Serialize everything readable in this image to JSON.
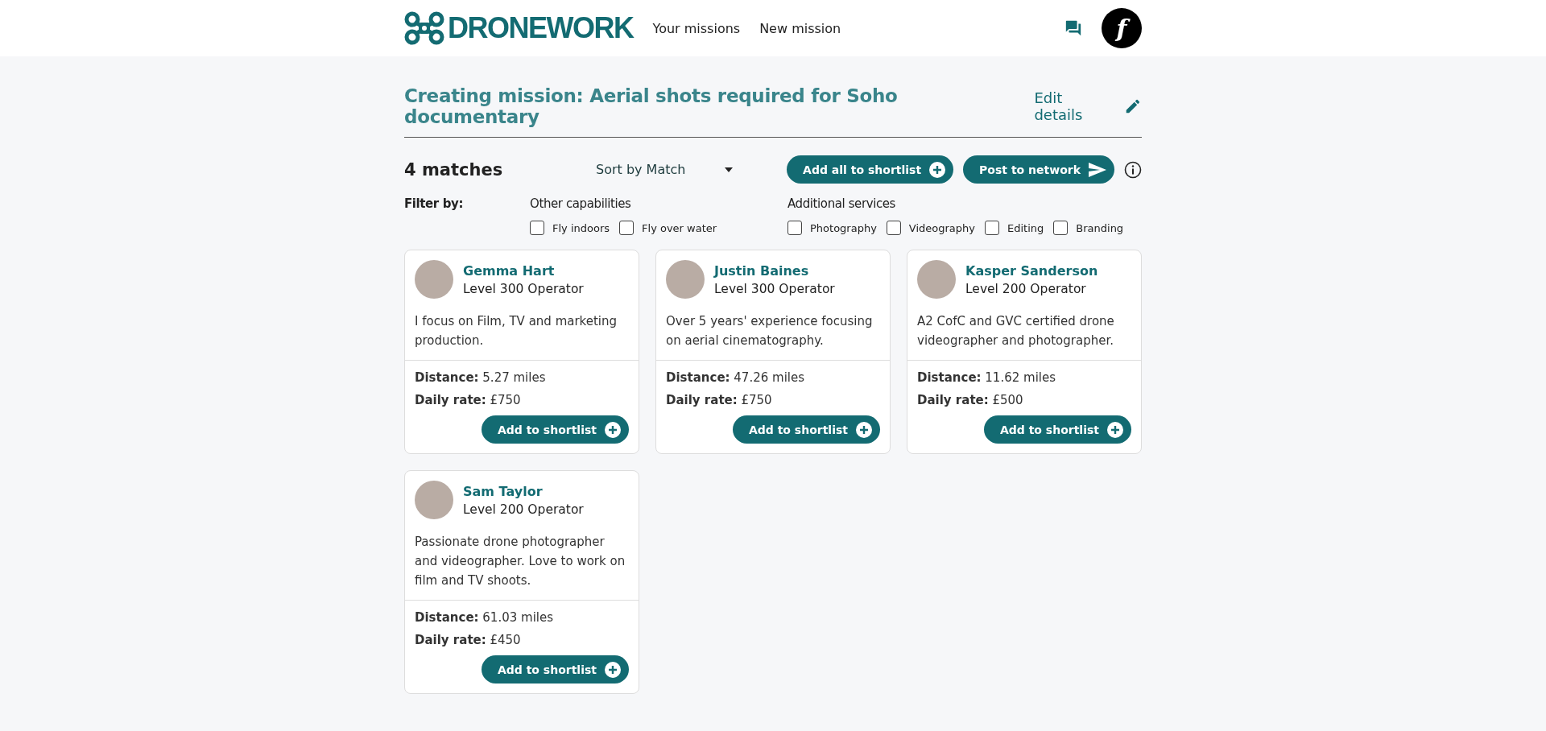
{
  "header": {
    "logo": "DRONEWORK",
    "nav": [
      {
        "label": "Your missions",
        "selected": false
      },
      {
        "label": "New mission",
        "selected": false
      }
    ],
    "avatar_letter": "f"
  },
  "page": {
    "title": "Creating mission: Aerial shots required for Soho documentary",
    "edit_link": "Edit details"
  },
  "toolbar": {
    "matches": "4 matches",
    "sort": "Sort by Match",
    "add_all": "Add all to shortlist",
    "post": "Post to network"
  },
  "filters": {
    "label": "Filter by:",
    "groups": [
      {
        "title": "Other capabilities",
        "options": [
          {
            "label": "Fly indoors",
            "checked": false
          },
          {
            "label": "Fly over water",
            "checked": false
          }
        ]
      },
      {
        "title": "Additional services",
        "options": [
          {
            "label": "Photography",
            "checked": false
          },
          {
            "label": "Videography",
            "checked": false
          },
          {
            "label": "Editing",
            "checked": false
          },
          {
            "label": "Branding",
            "checked": false
          }
        ]
      }
    ]
  },
  "operators": [
    {
      "name": "Gemma Hart",
      "level": "Level 300 Operator",
      "bio": "I focus on Film, TV and marketing production.",
      "distance": "**Distance:** 5.27 miles",
      "rate": "**Daily rate:** £750",
      "button": "Add to shortlist"
    },
    {
      "name": "Justin Baines",
      "level": "Level 300 Operator",
      "bio": "Over 5 years' experience focusing on aerial cinematography.",
      "distance": "**Distance:** 47.26 miles",
      "rate": "**Daily rate:** £750",
      "button": "Add to shortlist"
    },
    {
      "name": "Kasper Sanderson",
      "level": "Level 200 Operator",
      "bio": "A2 CofC and GVC certified drone videographer and photographer.",
      "distance": "**Distance:** 11.62 miles",
      "rate": "**Daily rate:** £500",
      "button": "Add to shortlist"
    },
    {
      "name": "Sam Taylor",
      "level": "Level 200 Operator",
      "bio": "Passionate drone photographer and videographer. Love to work on film and TV shoots.",
      "distance": "**Distance:** 61.03 miles",
      "rate": "**Daily rate:** £450",
      "button": "Add to shortlist"
    }
  ]
}
